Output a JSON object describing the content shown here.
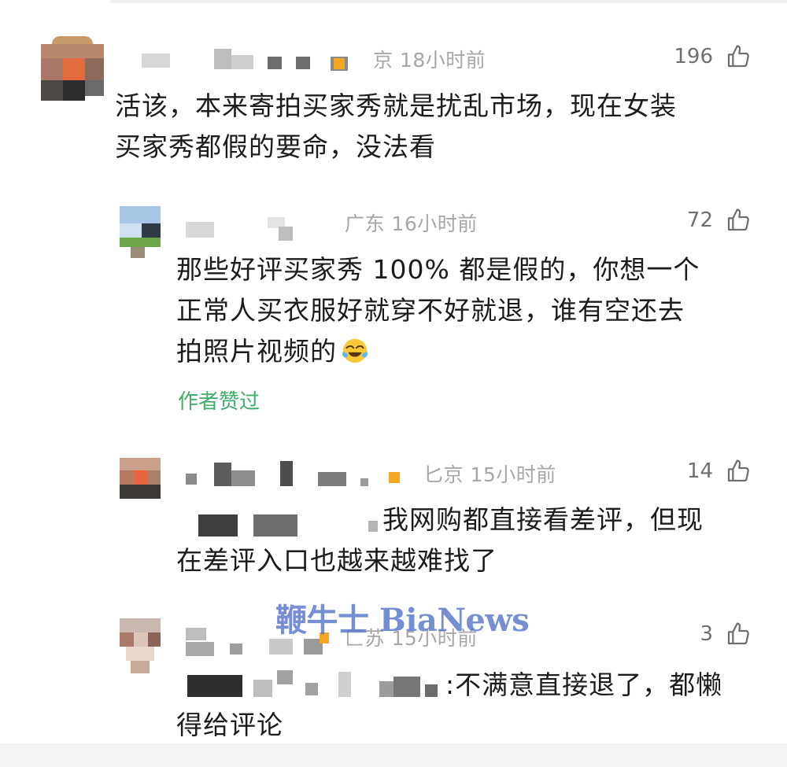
{
  "colors": {
    "meta_text": "#a7a7a7",
    "likes_text": "#6f6f6f",
    "body_text": "#1c1c1c",
    "author_liked": "#3fae6a",
    "watermark": "#506ec8",
    "location_badge": "#f5a623"
  },
  "icons": {
    "like": "thumbs-up-outline-icon",
    "emoji": "face-with-tears-of-joy-icon"
  },
  "comments": [
    {
      "meta": "京 18小时前",
      "likes": "196",
      "lines": [
        "活该，本来寄拍买家秀就是扰乱市场，现在女装",
        "买家秀都假的要命，没法看"
      ]
    },
    {
      "meta": "广东 16小时前",
      "likes": "72",
      "lines": [
        "那些好评买家秀 100% 都是假的，你想一个",
        "正常人买衣服好就穿不好就退，谁有空还去",
        "拍照片视频的"
      ],
      "author_liked": "作者赞过"
    },
    {
      "meta": "匕京 15小时前",
      "likes": "14",
      "lines": [
        "我网购都直接看差评，但现",
        "在差评入口也越来越难找了"
      ]
    },
    {
      "meta": "匚苏 15小时前",
      "likes": "3",
      "lines": [
        ":不满意直接退了，都懒",
        "得给评论"
      ]
    }
  ],
  "watermark": "鞭牛士 BiaNews"
}
